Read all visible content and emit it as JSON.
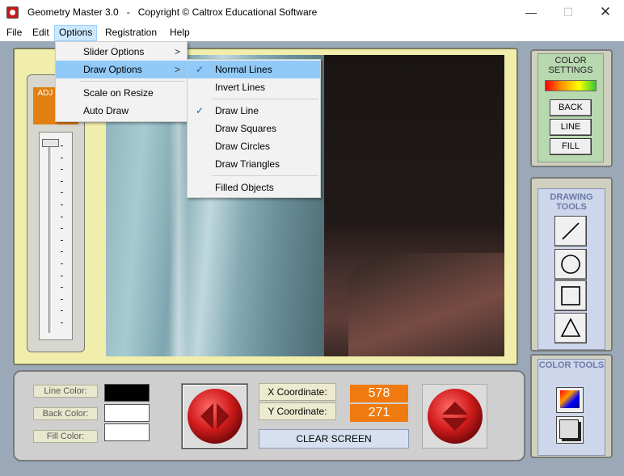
{
  "window": {
    "title": "Geometry Master 3.0   -   Copyright © Caltrox Educational Software",
    "minimize": "—",
    "maximize": "☐",
    "close": "✕"
  },
  "menubar": [
    "File",
    "Edit",
    "Options",
    "Registration",
    "Help"
  ],
  "options_menu": {
    "items": [
      "Slider Options",
      "Draw Options",
      "Scale on Resize",
      "Auto Draw"
    ],
    "selected": "Draw Options"
  },
  "draw_options_menu": {
    "items": [
      {
        "label": "Normal Lines",
        "checked": true,
        "selected": true
      },
      {
        "label": "Invert Lines",
        "checked": false
      },
      {
        "label": "Draw Line",
        "checked": true
      },
      {
        "label": "Draw Squares",
        "checked": false
      },
      {
        "label": "Draw Circles",
        "checked": false
      },
      {
        "label": "Draw Triangles",
        "checked": false
      },
      {
        "label": "Filled Objects",
        "checked": false
      }
    ],
    "check_mark": "✓",
    "submenu_arrow": ">"
  },
  "slider": {
    "label": "ADJ LI WI"
  },
  "color_settings": {
    "title": "COLOR SETTINGS",
    "buttons": [
      "BACK",
      "LINE",
      "FILL"
    ]
  },
  "drawing_tools": {
    "title": "DRAWING TOOLS",
    "tools": [
      "line-tool",
      "circle-tool",
      "square-tool",
      "triangle-tool"
    ]
  },
  "color_tools": {
    "title": "COLOR TOOLS"
  },
  "bottom": {
    "line_color_label": "Line Color:",
    "back_color_label": "Back Color:",
    "fill_color_label": "Fill Color:",
    "line_color": "#000000",
    "back_color": "#ffffff",
    "fill_color": "#ffffff",
    "x_label": "X Coordinate:",
    "y_label": "Y Coordinate:",
    "x_value": "578",
    "y_value": "271",
    "clear_button": "CLEAR SCREEN"
  },
  "colors": {
    "accent_orange": "#f07a10",
    "arrow_red": "#d42020",
    "menu_highlight": "#91c9f7"
  }
}
